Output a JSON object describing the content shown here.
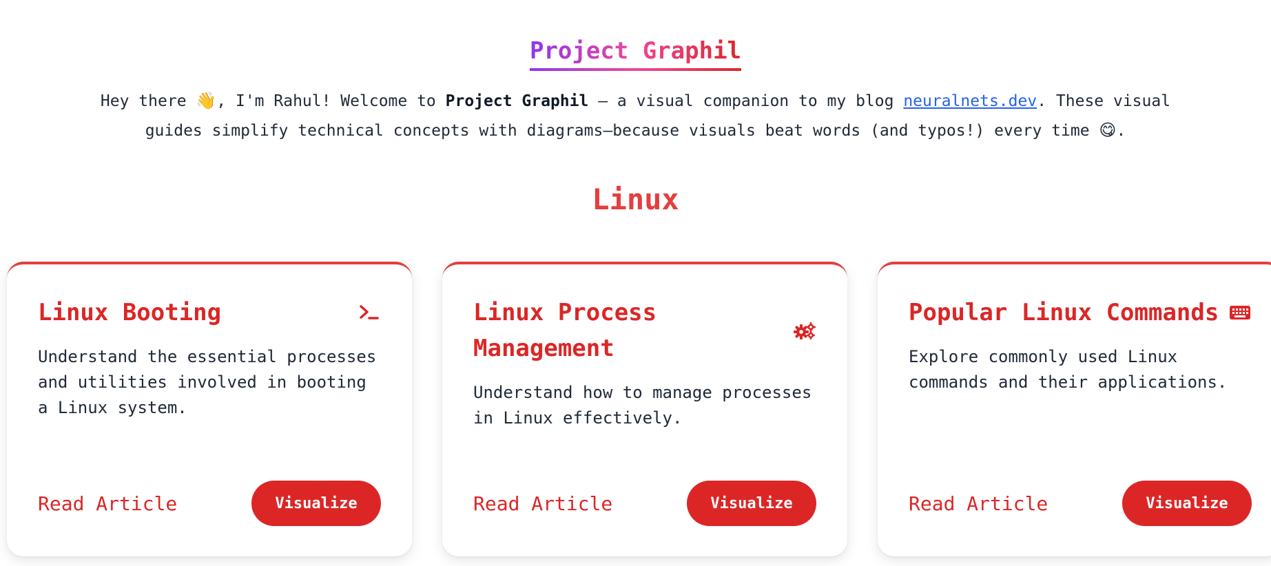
{
  "header": {
    "title": "Project Graphil",
    "intro": {
      "part1": "Hey there ",
      "emoji_wave": "👋",
      "part2": ", I'm Rahul! Welcome to ",
      "bold": "Project Graphil",
      "part3": " — a visual companion to my blog ",
      "link": "neuralnets.dev",
      "part4": ". These visual guides simplify technical concepts with diagrams—because visuals beat words (and typos!) every time ",
      "emoji_smile": "😋",
      "part5": "."
    }
  },
  "section": {
    "title": "Linux"
  },
  "cards": [
    {
      "title": "Linux Booting",
      "icon": "terminal-icon",
      "description": "Understand the essential processes and utilities involved in booting a Linux system.",
      "read_label": "Read Article",
      "visualize_label": "Visualize"
    },
    {
      "title": "Linux Process Management",
      "icon": "gears-icon",
      "description": "Understand how to manage processes in Linux effectively.",
      "read_label": "Read Article",
      "visualize_label": "Visualize"
    },
    {
      "title": "Popular Linux Commands",
      "icon": "keyboard-icon",
      "description": "Explore commonly used Linux commands and their applications.",
      "read_label": "Read Article",
      "visualize_label": "Visualize"
    }
  ],
  "colors": {
    "accent": "#dc2626",
    "link": "#2563eb",
    "title_gradient": [
      "#9333ea",
      "#ec4899",
      "#dc2626"
    ]
  }
}
